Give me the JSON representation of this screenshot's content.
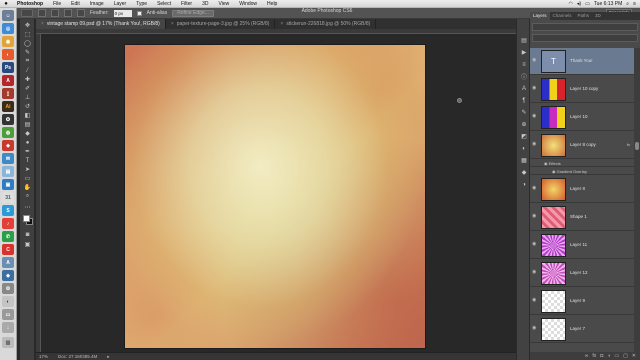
{
  "menubar": {
    "apple": "",
    "items": [
      "Photoshop",
      "File",
      "Edit",
      "Image",
      "Layer",
      "Type",
      "Select",
      "Filter",
      "3D",
      "View",
      "Window",
      "Help"
    ],
    "clock": "Tue 6:13 PM"
  },
  "app_title": "Adobe Photoshop CS6",
  "options_bar": {
    "feather_label": "Feather:",
    "feather_value": "0 px",
    "anti_alias_label": "Anti-alias",
    "refine_edge_label": "Refine Edge...",
    "workspace_label": "Essentials"
  },
  "doc_tabs": [
    {
      "label": "vintage stamp 09.psd @ 17% (Thank You!, RGB/8)",
      "active": true
    },
    {
      "label": "paper-texture-page-3.jpg @ 25% (RGB/8)",
      "active": false
    },
    {
      "label": "stickerun-226818.jpg @ 50% (RGB/8)",
      "active": false
    }
  ],
  "status": {
    "zoom": "17%",
    "doc_size": "Doc: 27.1M/385.4M"
  },
  "panel_tabs": [
    "Layers",
    "Channels",
    "Paths",
    "3D"
  ],
  "layers": [
    {
      "name": "Thank You!",
      "kind": "text",
      "selected": true
    },
    {
      "name": "Layer 10 copy",
      "kind": "stripes"
    },
    {
      "name": "Layer 10",
      "kind": "stripes"
    },
    {
      "name": "Layer 8 copy",
      "kind": "texture",
      "fx": true
    },
    {
      "name": "Layer 8",
      "kind": "texture"
    },
    {
      "name": "Shape 1",
      "kind": "pink"
    },
    {
      "name": "Layer 11",
      "kind": "purple"
    },
    {
      "name": "Layer 12",
      "kind": "purple2"
    },
    {
      "name": "Layer 9",
      "kind": "transparent"
    },
    {
      "name": "Layer 7",
      "kind": "transparent"
    }
  ],
  "layer_effects": {
    "effects_label": "Effects",
    "gradient_overlay_label": "Gradient Overlay"
  },
  "colors": {
    "menubar": "#e2e2e2",
    "chrome": "#535353",
    "panel": "#4a4a4a",
    "selection": "#6a7a91"
  }
}
